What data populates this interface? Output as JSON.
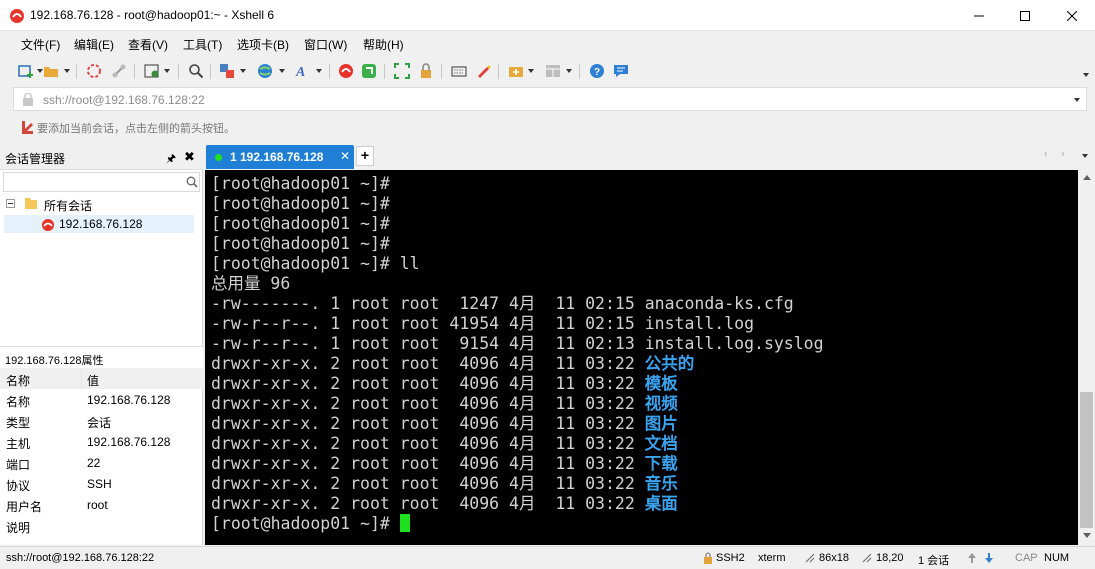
{
  "window": {
    "title": "192.168.76.128 - root@hadoop01:~ - Xshell 6"
  },
  "menu": [
    {
      "label": "文件(F)"
    },
    {
      "label": "编辑(E)"
    },
    {
      "label": "查看(V)"
    },
    {
      "label": "工具(T)"
    },
    {
      "label": "选项卡(B)"
    },
    {
      "label": "窗口(W)"
    },
    {
      "label": "帮助(H)"
    }
  ],
  "address_bar": {
    "value": "ssh://root@192.168.76.128:22"
  },
  "hint": {
    "text": "要添加当前会话，点击左侧的箭头按钮。"
  },
  "session_manager": {
    "title": "会话管理器",
    "search_value": "",
    "tree": {
      "root_label": "所有会话",
      "session_label": "192.168.76.128"
    }
  },
  "properties": {
    "title": "192.168.76.128属性",
    "col_name": "名称",
    "col_value": "值",
    "rows": [
      {
        "key": "名称",
        "value": "192.168.76.128"
      },
      {
        "key": "类型",
        "value": "会话"
      },
      {
        "key": "主机",
        "value": "192.168.76.128"
      },
      {
        "key": "端口",
        "value": "22"
      },
      {
        "key": "协议",
        "value": "SSH"
      },
      {
        "key": "用户名",
        "value": "root"
      },
      {
        "key": "说明",
        "value": ""
      }
    ]
  },
  "tabs": {
    "active": {
      "label": "1 192.168.76.128",
      "status_color": "#1ee01e"
    },
    "add_label": "+"
  },
  "terminal": {
    "prompt_lines": [
      "[root@hadoop01 ~]#",
      "[root@hadoop01 ~]#",
      "[root@hadoop01 ~]#",
      "[root@hadoop01 ~]#",
      "[root@hadoop01 ~]# ll"
    ],
    "total_line": "总用量 96",
    "listing": [
      {
        "meta": "-rw-------. 1 root root  1247 4月  11 02:15 ",
        "name": "anaconda-ks.cfg",
        "is_dir": false
      },
      {
        "meta": "-rw-r--r--. 1 root root 41954 4月  11 02:15 ",
        "name": "install.log",
        "is_dir": false
      },
      {
        "meta": "-rw-r--r--. 1 root root  9154 4月  11 02:13 ",
        "name": "install.log.syslog",
        "is_dir": false
      },
      {
        "meta": "drwxr-xr-x. 2 root root  4096 4月  11 03:22 ",
        "name": "公共的",
        "is_dir": true
      },
      {
        "meta": "drwxr-xr-x. 2 root root  4096 4月  11 03:22 ",
        "name": "模板",
        "is_dir": true
      },
      {
        "meta": "drwxr-xr-x. 2 root root  4096 4月  11 03:22 ",
        "name": "视频",
        "is_dir": true
      },
      {
        "meta": "drwxr-xr-x. 2 root root  4096 4月  11 03:22 ",
        "name": "图片",
        "is_dir": true
      },
      {
        "meta": "drwxr-xr-x. 2 root root  4096 4月  11 03:22 ",
        "name": "文档",
        "is_dir": true
      },
      {
        "meta": "drwxr-xr-x. 2 root root  4096 4月  11 03:22 ",
        "name": "下载",
        "is_dir": true
      },
      {
        "meta": "drwxr-xr-x. 2 root root  4096 4月  11 03:22 ",
        "name": "音乐",
        "is_dir": true
      },
      {
        "meta": "drwxr-xr-x. 2 root root  4096 4月  11 03:22 ",
        "name": "桌面",
        "is_dir": true
      }
    ],
    "final_prompt": "[root@hadoop01 ~]# ",
    "text_color": "#d2d2d2",
    "dir_color": "#3ba3f0",
    "cursor_color": "#1ee01e",
    "background": "#000000"
  },
  "status_bar": {
    "connection": "ssh://root@192.168.76.128:22",
    "protocol": "SSH2",
    "terminal_type": "xterm",
    "size": "86x18",
    "cursor_pos": "18,20",
    "sessions": "1 会话",
    "caps": "CAP",
    "num": "NUM"
  }
}
